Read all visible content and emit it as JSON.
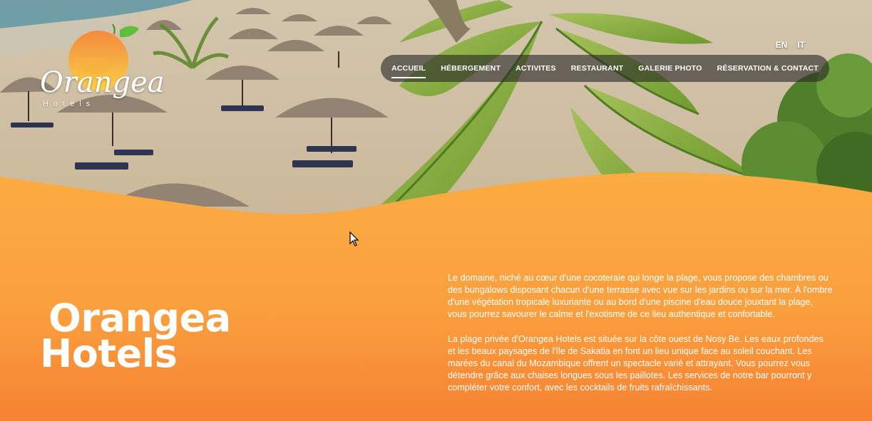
{
  "logo": {
    "wordmark": "Orangea",
    "tagline": "Hotels"
  },
  "languages": [
    "EN",
    "IT"
  ],
  "nav": {
    "items": [
      {
        "label": "ACCUEIL",
        "active": true
      },
      {
        "label": "HÉBERGEMENT",
        "active": false
      },
      {
        "label": "ACTIVITES",
        "active": false
      },
      {
        "label": "RESTAURANT",
        "active": false
      },
      {
        "label": "GALERIE PHOTO",
        "active": false
      },
      {
        "label": "RÉSERVATION & CONTACT",
        "active": false
      }
    ]
  },
  "hero_image": "beach-parasols-palms-photo",
  "main": {
    "title_line1": "Orangea",
    "title_line2": "Hotels",
    "paragraphs": [
      "Le domaine, niché au cœur d'une cocoteraie qui longe la plage, vous propose des chambres ou des bungalows disposant chacun d'une terrasse avec vue sur les jardins ou sur la mer. À l'ombre d'une végétation tropicale luxuriante ou au bord d'une piscine d'eau douce jouxtant la plage, vous pourrez savourer le calme et l'exotisme de ce lieu authentique et confortable.",
      "La plage privée d'Orangea Hotels est située sur la côte ouest de Nosy Be. Les eaux profondes et les beaux paysages de l'île de Sakatia en font un lieu unique face au soleil couchant. Les marées du canal du Mozambique offrent un spectacle varié et attrayant. Vous pourrez vous détendre grâce aux chaises longues sous les paillotes. Les services de notre bar pourront y compléter votre confort, avec les cocktails de fruits rafraîchissants."
    ]
  },
  "colors": {
    "orange_top": "#fbab43",
    "orange_bottom": "#f68436",
    "sand": "#d9c9ad",
    "palm_green": "#7fa53a"
  }
}
